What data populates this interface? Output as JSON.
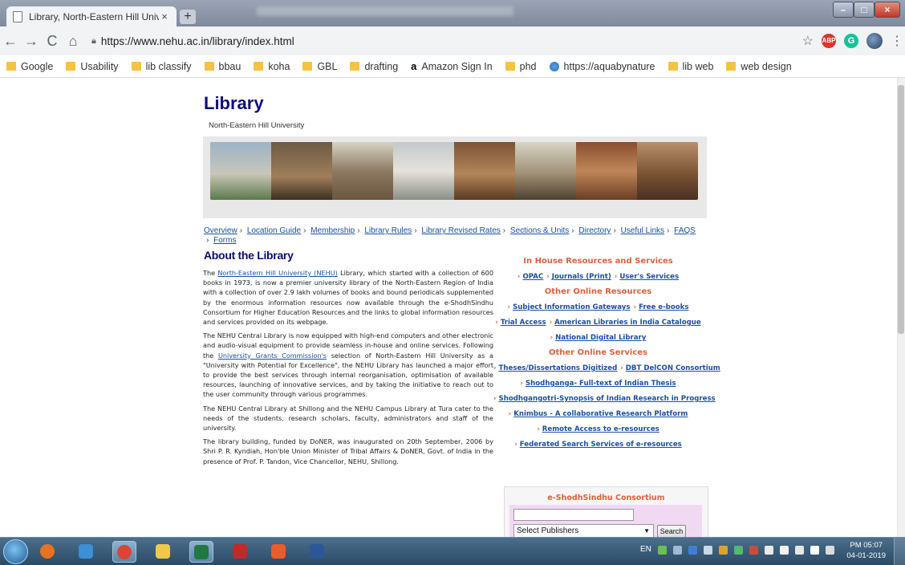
{
  "browser": {
    "tab_title": "Library, North-Eastern Hill Univer",
    "tab_close": "×",
    "newtab": "+",
    "window_controls": [
      "–",
      "□",
      "×"
    ],
    "nav_buttons": [
      "←",
      "→",
      "C",
      "⌂"
    ],
    "url": "https://www.nehu.ac.in/library/index.html",
    "extensions": [
      "ABP",
      "G"
    ],
    "menu": "⋮",
    "bookmarks": [
      {
        "label": "Google",
        "icon": "folder"
      },
      {
        "label": "Usability",
        "icon": "folder"
      },
      {
        "label": "lib classify",
        "icon": "folder"
      },
      {
        "label": "bbau",
        "icon": "folder"
      },
      {
        "label": "koha",
        "icon": "folder"
      },
      {
        "label": "GBL",
        "icon": "folder"
      },
      {
        "label": "drafting",
        "icon": "folder"
      },
      {
        "label": "Amazon Sign In",
        "icon": "amazon"
      },
      {
        "label": "phd",
        "icon": "folder"
      },
      {
        "label": "https://aquabynature",
        "icon": "globe"
      },
      {
        "label": "lib web",
        "icon": "folder"
      },
      {
        "label": "web design",
        "icon": "folder"
      }
    ]
  },
  "site": {
    "title": "Library",
    "subtitle": "North-Eastern Hill University"
  },
  "nav": {
    "links": [
      "Overview",
      "Location Guide",
      "Membership",
      "Library Rules",
      "Library Revised Rates",
      "Sections & Units",
      "Directory",
      "Useful Links",
      "FAQS",
      "Forms"
    ]
  },
  "about": {
    "heading": "About the Library",
    "p1_pre": "The ",
    "p1_link": "North-Eastern Hill University (NEHU)",
    "p1_post": " Library, which started with a collection of 600 books in 1973, is now a premier university library of the North-Eastern Region of India with a collection of over 2.9 lakh volumes of books and bound periodicals supplemented by the enormous information resources now available through the e-ShodhSindhu Consortium for Higher Education Resources and the links to global information resources and services provided on its webpage.",
    "p2_pre": "The NEHU Central Library is now equipped with high-end computers and other electronic and audio-visual equipment to provide seamless in-house and online services. Following the ",
    "p2_link": "University Grants Commission's",
    "p2_post": " selection of North-Eastern Hill University as a \"University with Potential for Excellence\", the NEHU Library has launched a major effort to provide the best services through internal reorganisation, optimisation of available resources, launching of innovative services, and by taking the initiative to reach out to the user community through various programmes.",
    "p3": "The NEHU Central Library at Shillong and the NEHU Campus Library at Tura cater to the needs of the students, research scholars, faculty, administrators and staff of the university.",
    "p4": "The library building, funded by DoNER, was inaugurated on 20th September, 2006 by Shri P. R. Kyndiah, Hon'ble Union Minister of Tribal Affairs & DoNER, Govt. of India in the presence of Prof. P. Tandon, Vice Chancellor, NEHU, Shillong."
  },
  "right_panel": {
    "rows": [
      {
        "heading": "In House Resources and Services"
      },
      {
        "links": [
          "OPAC",
          "Journals (Print)",
          "User's Services"
        ]
      },
      {
        "heading": "Other Online Resources"
      },
      {
        "links": [
          "Subject Information Gateways",
          "Free e-books"
        ]
      },
      {
        "links": [
          "Trial Access",
          "American Libraries in India Catalogue"
        ]
      },
      {
        "links": [
          "National Digital Library"
        ]
      },
      {
        "heading": "Other Online Services"
      },
      {
        "links": [
          "Theses/Dissertations Digitized",
          "DBT DelCON Consortium"
        ]
      },
      {
        "links": [
          "Shodhganga- Full-text of Indian Thesis"
        ]
      },
      {
        "links": [
          "Shodhgangotri-Synopsis of Indian Research in Progress"
        ]
      },
      {
        "links": [
          "Knimbus - A collaborative Research Platform"
        ]
      },
      {
        "links": [
          "Remote Access to e-resources"
        ]
      },
      {
        "links": [
          "Federated Search Services of e-resources"
        ]
      }
    ]
  },
  "consortium": {
    "title": "e-ShodhSindhu Consortium",
    "input_value": "",
    "select_value": "Select Publishers",
    "button": "Search"
  },
  "taskbar": {
    "apps": [
      "firefox",
      "paint",
      "chrome",
      "explorer",
      "excel",
      "filezilla",
      "app",
      "word"
    ],
    "lang": "EN",
    "time": "PM 05:07",
    "date": "04-01-2019"
  },
  "colors": {
    "title_navy": "#0e0e7e",
    "link_blue": "#1a4fa3",
    "accent_orange": "#e2603b",
    "box_lilac": "#f1d9f4"
  }
}
